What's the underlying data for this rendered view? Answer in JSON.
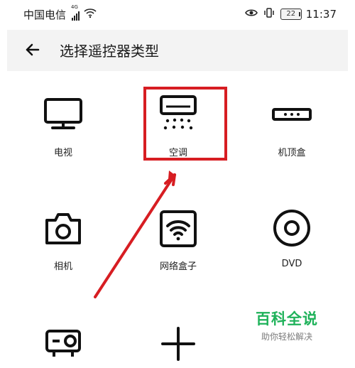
{
  "status_bar": {
    "carrier": "中国电信",
    "network": "4G",
    "battery": "22",
    "time": "11:37"
  },
  "header": {
    "title": "选择遥控器类型"
  },
  "grid": {
    "tv": "电视",
    "ac": "空调",
    "stb": "机顶盒",
    "camera": "相机",
    "network_box": "网络盒子",
    "dvd": "DVD"
  },
  "watermark": {
    "title": "百科全说",
    "subtitle": "助你轻松解决"
  },
  "colors": {
    "highlight": "#d71d22",
    "brand": "#1fb25a",
    "header_bg": "#f3f3f3"
  }
}
